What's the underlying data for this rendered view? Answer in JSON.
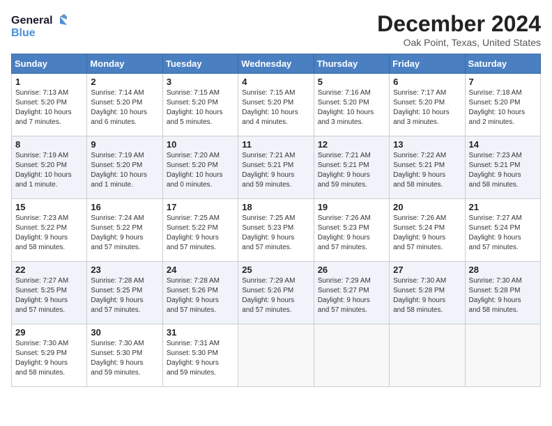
{
  "header": {
    "logo_line1": "General",
    "logo_line2": "Blue",
    "month_title": "December 2024",
    "location": "Oak Point, Texas, United States"
  },
  "weekdays": [
    "Sunday",
    "Monday",
    "Tuesday",
    "Wednesday",
    "Thursday",
    "Friday",
    "Saturday"
  ],
  "weeks": [
    [
      {
        "day": "1",
        "lines": [
          "Sunrise: 7:13 AM",
          "Sunset: 5:20 PM",
          "Daylight: 10 hours",
          "and 7 minutes."
        ]
      },
      {
        "day": "2",
        "lines": [
          "Sunrise: 7:14 AM",
          "Sunset: 5:20 PM",
          "Daylight: 10 hours",
          "and 6 minutes."
        ]
      },
      {
        "day": "3",
        "lines": [
          "Sunrise: 7:15 AM",
          "Sunset: 5:20 PM",
          "Daylight: 10 hours",
          "and 5 minutes."
        ]
      },
      {
        "day": "4",
        "lines": [
          "Sunrise: 7:15 AM",
          "Sunset: 5:20 PM",
          "Daylight: 10 hours",
          "and 4 minutes."
        ]
      },
      {
        "day": "5",
        "lines": [
          "Sunrise: 7:16 AM",
          "Sunset: 5:20 PM",
          "Daylight: 10 hours",
          "and 3 minutes."
        ]
      },
      {
        "day": "6",
        "lines": [
          "Sunrise: 7:17 AM",
          "Sunset: 5:20 PM",
          "Daylight: 10 hours",
          "and 3 minutes."
        ]
      },
      {
        "day": "7",
        "lines": [
          "Sunrise: 7:18 AM",
          "Sunset: 5:20 PM",
          "Daylight: 10 hours",
          "and 2 minutes."
        ]
      }
    ],
    [
      {
        "day": "8",
        "lines": [
          "Sunrise: 7:19 AM",
          "Sunset: 5:20 PM",
          "Daylight: 10 hours",
          "and 1 minute."
        ]
      },
      {
        "day": "9",
        "lines": [
          "Sunrise: 7:19 AM",
          "Sunset: 5:20 PM",
          "Daylight: 10 hours",
          "and 1 minute."
        ]
      },
      {
        "day": "10",
        "lines": [
          "Sunrise: 7:20 AM",
          "Sunset: 5:20 PM",
          "Daylight: 10 hours",
          "and 0 minutes."
        ]
      },
      {
        "day": "11",
        "lines": [
          "Sunrise: 7:21 AM",
          "Sunset: 5:21 PM",
          "Daylight: 9 hours",
          "and 59 minutes."
        ]
      },
      {
        "day": "12",
        "lines": [
          "Sunrise: 7:21 AM",
          "Sunset: 5:21 PM",
          "Daylight: 9 hours",
          "and 59 minutes."
        ]
      },
      {
        "day": "13",
        "lines": [
          "Sunrise: 7:22 AM",
          "Sunset: 5:21 PM",
          "Daylight: 9 hours",
          "and 58 minutes."
        ]
      },
      {
        "day": "14",
        "lines": [
          "Sunrise: 7:23 AM",
          "Sunset: 5:21 PM",
          "Daylight: 9 hours",
          "and 58 minutes."
        ]
      }
    ],
    [
      {
        "day": "15",
        "lines": [
          "Sunrise: 7:23 AM",
          "Sunset: 5:22 PM",
          "Daylight: 9 hours",
          "and 58 minutes."
        ]
      },
      {
        "day": "16",
        "lines": [
          "Sunrise: 7:24 AM",
          "Sunset: 5:22 PM",
          "Daylight: 9 hours",
          "and 57 minutes."
        ]
      },
      {
        "day": "17",
        "lines": [
          "Sunrise: 7:25 AM",
          "Sunset: 5:22 PM",
          "Daylight: 9 hours",
          "and 57 minutes."
        ]
      },
      {
        "day": "18",
        "lines": [
          "Sunrise: 7:25 AM",
          "Sunset: 5:23 PM",
          "Daylight: 9 hours",
          "and 57 minutes."
        ]
      },
      {
        "day": "19",
        "lines": [
          "Sunrise: 7:26 AM",
          "Sunset: 5:23 PM",
          "Daylight: 9 hours",
          "and 57 minutes."
        ]
      },
      {
        "day": "20",
        "lines": [
          "Sunrise: 7:26 AM",
          "Sunset: 5:24 PM",
          "Daylight: 9 hours",
          "and 57 minutes."
        ]
      },
      {
        "day": "21",
        "lines": [
          "Sunrise: 7:27 AM",
          "Sunset: 5:24 PM",
          "Daylight: 9 hours",
          "and 57 minutes."
        ]
      }
    ],
    [
      {
        "day": "22",
        "lines": [
          "Sunrise: 7:27 AM",
          "Sunset: 5:25 PM",
          "Daylight: 9 hours",
          "and 57 minutes."
        ]
      },
      {
        "day": "23",
        "lines": [
          "Sunrise: 7:28 AM",
          "Sunset: 5:25 PM",
          "Daylight: 9 hours",
          "and 57 minutes."
        ]
      },
      {
        "day": "24",
        "lines": [
          "Sunrise: 7:28 AM",
          "Sunset: 5:26 PM",
          "Daylight: 9 hours",
          "and 57 minutes."
        ]
      },
      {
        "day": "25",
        "lines": [
          "Sunrise: 7:29 AM",
          "Sunset: 5:26 PM",
          "Daylight: 9 hours",
          "and 57 minutes."
        ]
      },
      {
        "day": "26",
        "lines": [
          "Sunrise: 7:29 AM",
          "Sunset: 5:27 PM",
          "Daylight: 9 hours",
          "and 57 minutes."
        ]
      },
      {
        "day": "27",
        "lines": [
          "Sunrise: 7:30 AM",
          "Sunset: 5:28 PM",
          "Daylight: 9 hours",
          "and 58 minutes."
        ]
      },
      {
        "day": "28",
        "lines": [
          "Sunrise: 7:30 AM",
          "Sunset: 5:28 PM",
          "Daylight: 9 hours",
          "and 58 minutes."
        ]
      }
    ],
    [
      {
        "day": "29",
        "lines": [
          "Sunrise: 7:30 AM",
          "Sunset: 5:29 PM",
          "Daylight: 9 hours",
          "and 58 minutes."
        ]
      },
      {
        "day": "30",
        "lines": [
          "Sunrise: 7:30 AM",
          "Sunset: 5:30 PM",
          "Daylight: 9 hours",
          "and 59 minutes."
        ]
      },
      {
        "day": "31",
        "lines": [
          "Sunrise: 7:31 AM",
          "Sunset: 5:30 PM",
          "Daylight: 9 hours",
          "and 59 minutes."
        ]
      },
      null,
      null,
      null,
      null
    ]
  ]
}
